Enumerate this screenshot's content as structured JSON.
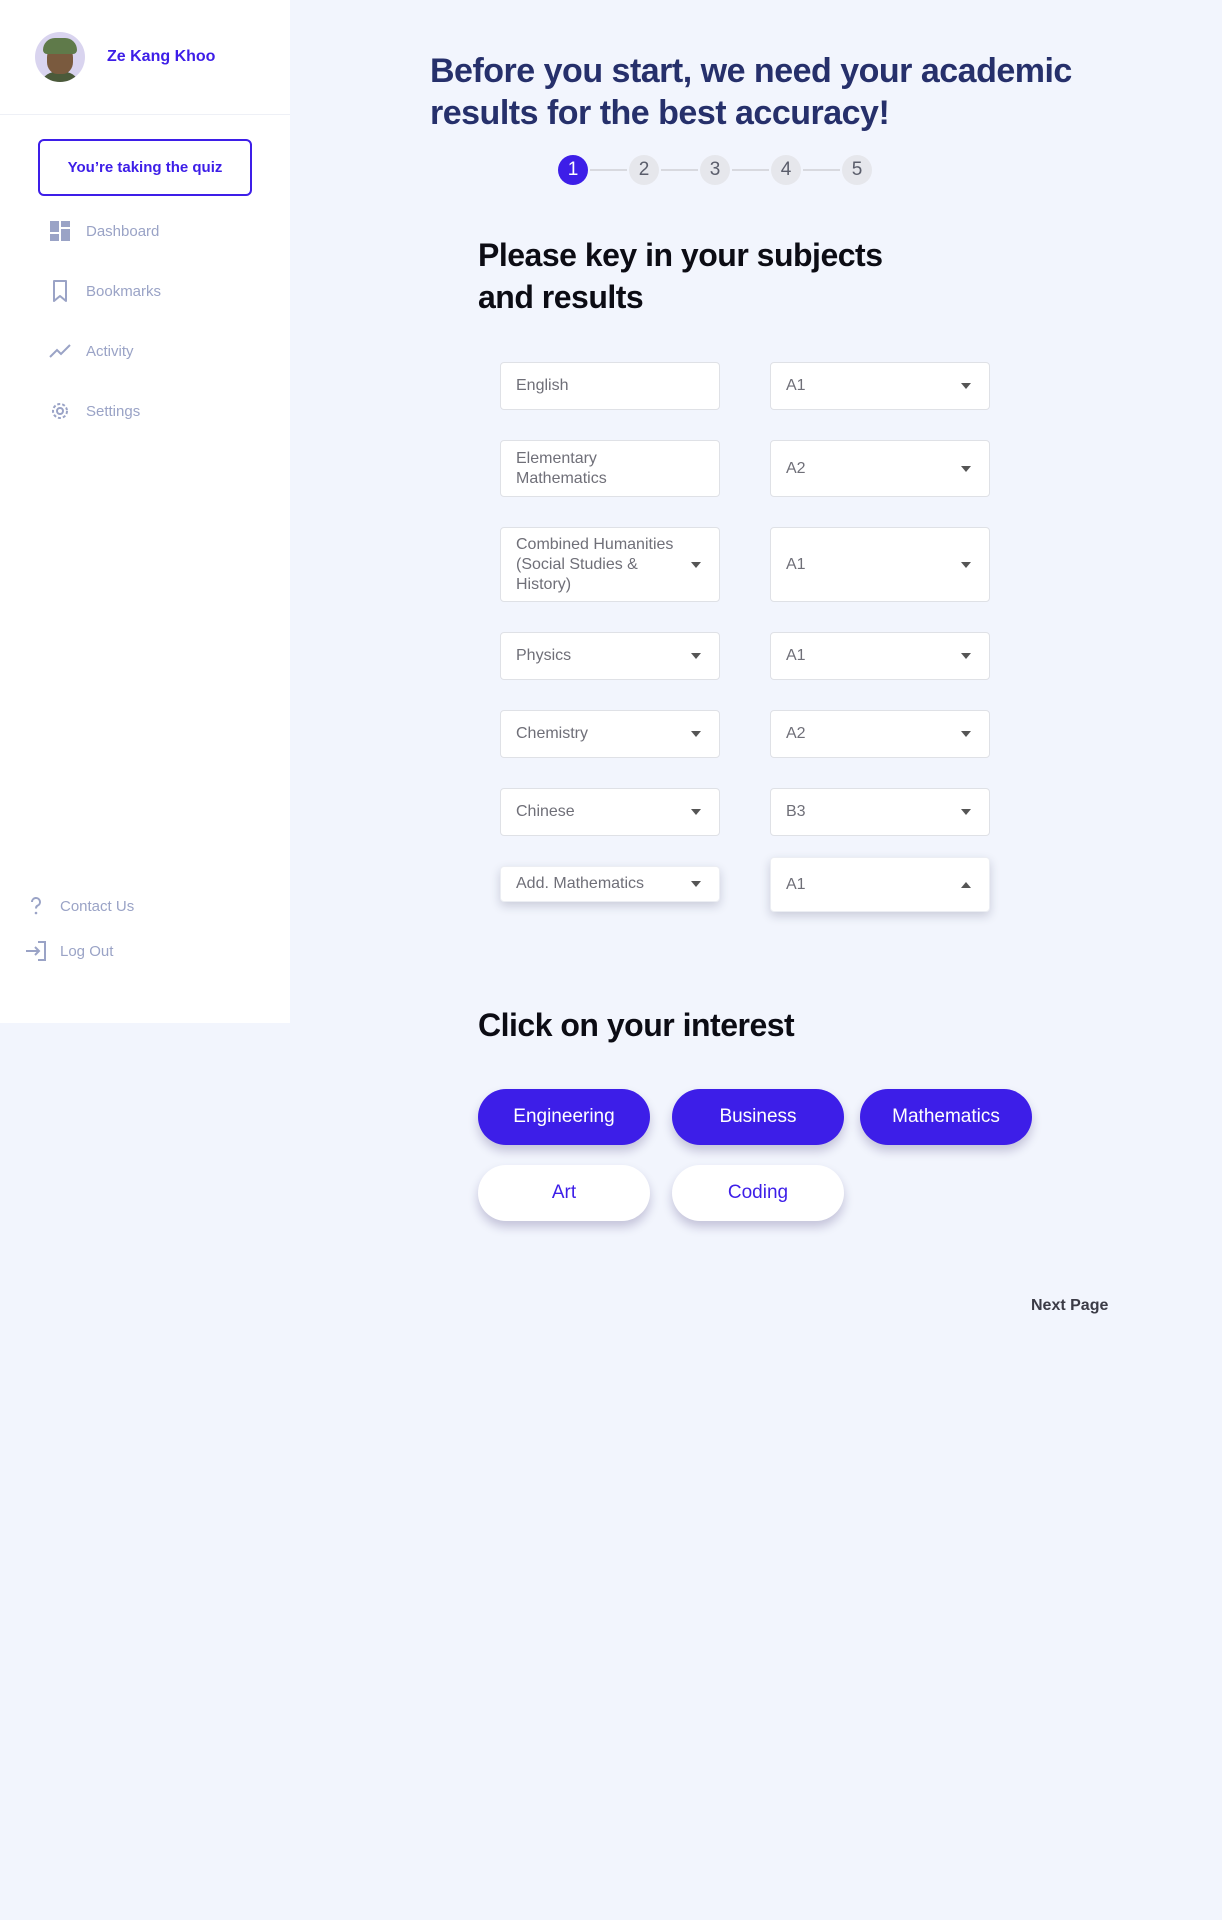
{
  "sidebar": {
    "user_name": "Ze Kang Khoo",
    "quiz_button": "You’re taking the quiz",
    "nav": [
      "Dashboard",
      "Bookmarks",
      "Activity",
      "Settings"
    ],
    "bottom_nav": [
      "Contact Us",
      "Log Out"
    ]
  },
  "main": {
    "headline": "Before you start, we need your academic results for the best accuracy!",
    "steps": [
      "1",
      "2",
      "3",
      "4",
      "5"
    ],
    "active_step": "1",
    "subjects_title": "Please key in your subjects and results",
    "subjects": [
      {
        "subject": "English",
        "grade": "A1"
      },
      {
        "subject": "Elementary Mathematics",
        "grade": "A2"
      },
      {
        "subject": "Combined Humanities (Social Studies & History)",
        "grade": "A1"
      },
      {
        "subject": "Physics",
        "grade": "A1"
      },
      {
        "subject": "Chemistry",
        "grade": "A2"
      },
      {
        "subject": "Chinese",
        "grade": "B3"
      },
      {
        "subject": "Add. Mathematics",
        "grade": "A1"
      }
    ],
    "interest_title": "Click on your interest",
    "interests": [
      {
        "label": "Engineering",
        "selected": true
      },
      {
        "label": "Business",
        "selected": true
      },
      {
        "label": "Mathematics",
        "selected": true
      },
      {
        "label": "Art",
        "selected": false
      },
      {
        "label": "Coding",
        "selected": false
      }
    ],
    "next_page": "Next Page"
  },
  "colors": {
    "accent": "#3d1ee8",
    "headline": "#26306b",
    "background": "#f2f5fd"
  }
}
